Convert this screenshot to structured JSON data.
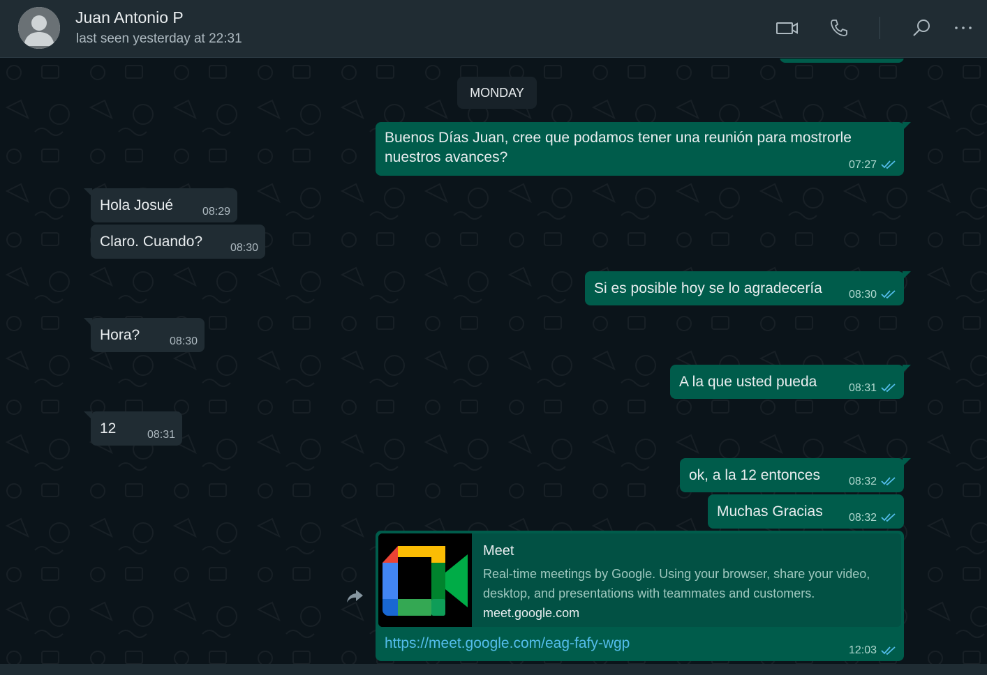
{
  "header": {
    "contact_name": "Juan Antonio P",
    "status": "last seen yesterday at 22:31"
  },
  "day_divider": "MONDAY",
  "messages": [
    {
      "dir": "out",
      "line1": "Buenos Días Juan, cree que podamos tener una reunión para mostrorle",
      "line2": "nuestros avances?",
      "time": "07:27"
    },
    {
      "dir": "in",
      "text": "Hola Josué",
      "time": "08:29"
    },
    {
      "dir": "in",
      "text": "Claro. Cuando?",
      "time": "08:30"
    },
    {
      "dir": "out",
      "text": "Si es posible hoy se lo agradecería",
      "time": "08:30"
    },
    {
      "dir": "in",
      "text": "Hora?",
      "time": "08:30"
    },
    {
      "dir": "out",
      "text": "A la que usted pueda",
      "time": "08:31"
    },
    {
      "dir": "in",
      "text": "12",
      "time": "08:31"
    },
    {
      "dir": "out",
      "text": "ok, a la 12 entonces",
      "time": "08:32"
    },
    {
      "dir": "out",
      "text": "Muchas Gracias",
      "time": "08:32"
    }
  ],
  "link_message": {
    "preview_title": "Meet",
    "preview_description_1": "Real-time meetings by Google. Using your browser, share your video,",
    "preview_description_2": "desktop, and presentations with teammates and customers.",
    "preview_domain": "meet.google.com",
    "url": "https://meet.google.com/eag-fafy-wgp",
    "time": "12:03"
  },
  "colors": {
    "incoming_bubble": "#202c33",
    "outgoing_bubble": "#005c4b",
    "read_tick": "#53bdeb",
    "link": "#53bdeb"
  },
  "icons": [
    "video-call-icon",
    "voice-call-icon",
    "search-icon",
    "menu-icon",
    "forward-icon",
    "double-check-icon"
  ]
}
